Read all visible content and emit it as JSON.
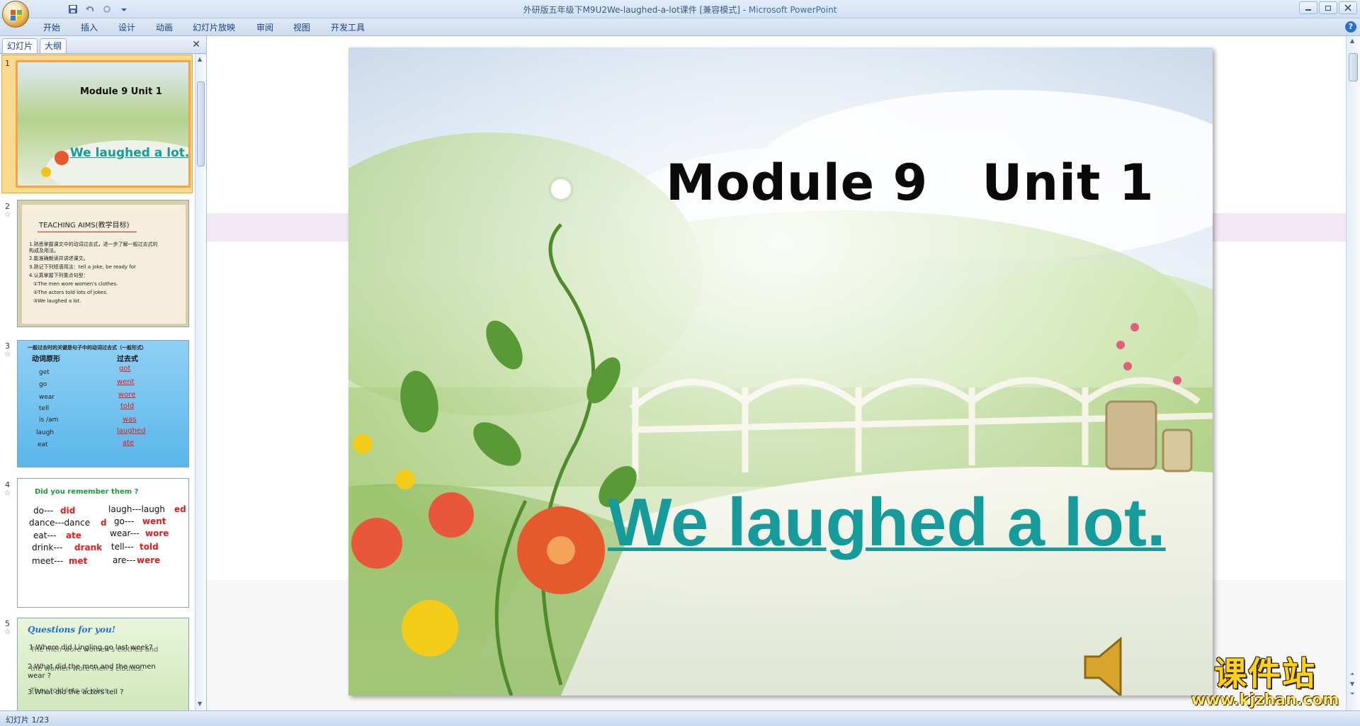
{
  "window": {
    "title_doc": "外研版五年级下M9U2We-laughed-a-lot课件 [兼容模式]",
    "title_sep": " - ",
    "title_app": "Microsoft PowerPoint"
  },
  "ribbon_tabs": [
    "开始",
    "插入",
    "设计",
    "动画",
    "幻灯片放映",
    "审阅",
    "视图",
    "开发工具"
  ],
  "pane_tabs": {
    "slides": "幻灯片",
    "outline": "大纲"
  },
  "thumbnails": {
    "s1": {
      "num": "1",
      "title": "Module 9  Unit 1",
      "subtitle": "We laughed a lot."
    },
    "s2": {
      "num": "2",
      "heading": "TEACHING  AIMS(教学目标)",
      "lines": [
        "1.熟悉掌握课文中的动词过去式，进一步了解一般过去式的",
        "构成及用法。",
        "2.能准确朗读并讲述课文。",
        "3.熟记下列短语用法：tell a joke,  be ready for",
        "4.认真掌握下列重点句型：",
        "①The men wore women's clothes.",
        "②The actors told lots of jokes.",
        "③We laughed a lot."
      ]
    },
    "s3": {
      "num": "3",
      "heading": "一般过去时的关键是句子中的动词过去式（一般形式）",
      "col1": "动词原形",
      "col2": "过去式",
      "rows": [
        [
          "get",
          "got"
        ],
        [
          "go",
          "went"
        ],
        [
          "wear",
          "wore"
        ],
        [
          "tell",
          "told"
        ],
        [
          "is /am",
          "was"
        ],
        [
          "laugh",
          "laughed"
        ],
        [
          "eat",
          "ate"
        ]
      ]
    },
    "s4": {
      "num": "4",
      "heading": "Did  you  remember them ?",
      "left": [
        [
          "do---",
          "did"
        ],
        [
          "dance---dance",
          "d"
        ],
        [
          "eat---",
          "ate"
        ],
        [
          "drink---",
          "drank"
        ],
        [
          "meet---",
          "met"
        ]
      ],
      "right": [
        [
          "laugh---laugh",
          "ed"
        ],
        [
          "go---",
          "went"
        ],
        [
          "wear---",
          "wore"
        ],
        [
          "tell---",
          "told"
        ],
        [
          "are---",
          "were"
        ]
      ]
    },
    "s5": {
      "num": "5",
      "heading": "Questions for you!",
      "lines": [
        "1.Where did Lingling go last week?",
        "2.What did the men and the women",
        "wear ?",
        "3.What did the actors tell ?"
      ],
      "overlay": [
        "The men wore women's clothes and",
        "the women wore men's clothes.",
        "They told lots of jokes."
      ]
    }
  },
  "slide": {
    "title": "Module 9   Unit 1",
    "subtitle": "We laughed a lot."
  },
  "status": {
    "slide_indicator": "幻灯片 1/23"
  },
  "watermark": {
    "cn": "课件站",
    "url": "www.kjzhan.com"
  },
  "colors": {
    "accent": "#179a9a",
    "selection": "#f2a54a",
    "ribbon": "#cedced"
  }
}
